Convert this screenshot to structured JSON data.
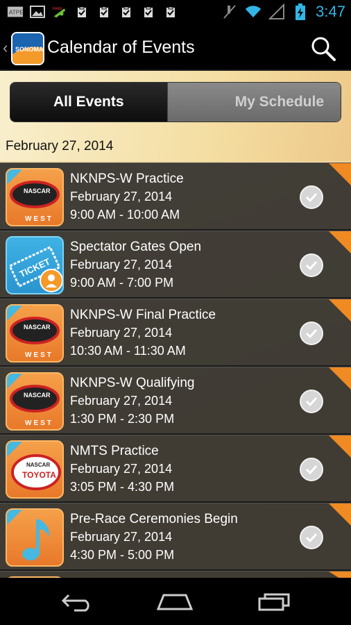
{
  "status_bar": {
    "time": "3:47",
    "left_icons": [
      "atpe-icon",
      "image-icon",
      "fake-gps-icon",
      "check-box-icon",
      "check-box-icon",
      "check-box-icon",
      "check-box-icon",
      "check-box-icon"
    ],
    "atpe_label": "ATPE",
    "fake_label": "FAKE",
    "right_icons": [
      "mute-icon",
      "wifi-icon",
      "signal-icon",
      "battery-charging-icon"
    ]
  },
  "action_bar": {
    "title": "Calendar of Events",
    "logo_text": "SONOMA"
  },
  "segmented": {
    "all_events": "All Events",
    "my_schedule": "My Schedule"
  },
  "date_header": "February 27, 2014",
  "events": [
    {
      "name": "NKNPS-W Practice",
      "date": "February 27, 2014",
      "time": "9:00 AM - 10:00 AM",
      "icon": "nascar-west-icon"
    },
    {
      "name": "Spectator Gates Open",
      "date": "February 27, 2014",
      "time": "9:00 AM - 7:00 PM",
      "icon": "ticket-icon"
    },
    {
      "name": "NKNPS-W Final Practice",
      "date": "February 27, 2014",
      "time": "10:30 AM - 11:30 AM",
      "icon": "nascar-west-icon"
    },
    {
      "name": "NKNPS-W Qualifying",
      "date": "February 27, 2014",
      "time": "1:30 PM - 2:30 PM",
      "icon": "nascar-west-icon"
    },
    {
      "name": "NMTS Practice",
      "date": "February 27, 2014",
      "time": "3:05 PM - 4:30 PM",
      "icon": "nascar-toyota-icon"
    },
    {
      "name": "Pre-Race Ceremonies Begin",
      "date": "February 27, 2014",
      "time": "4:30 PM - 5:00 PM",
      "icon": "music-note-icon"
    }
  ],
  "icon_text": {
    "nascar": "NASCAR",
    "west": "WEST",
    "ticket": "TICKET",
    "toyota": "TOYOTA"
  },
  "colors": {
    "accent_blue": "#33b5e5",
    "flag_orange": "#f08a22",
    "icon_orange": "#e8792a",
    "corner_blue": "#47b8e0"
  }
}
